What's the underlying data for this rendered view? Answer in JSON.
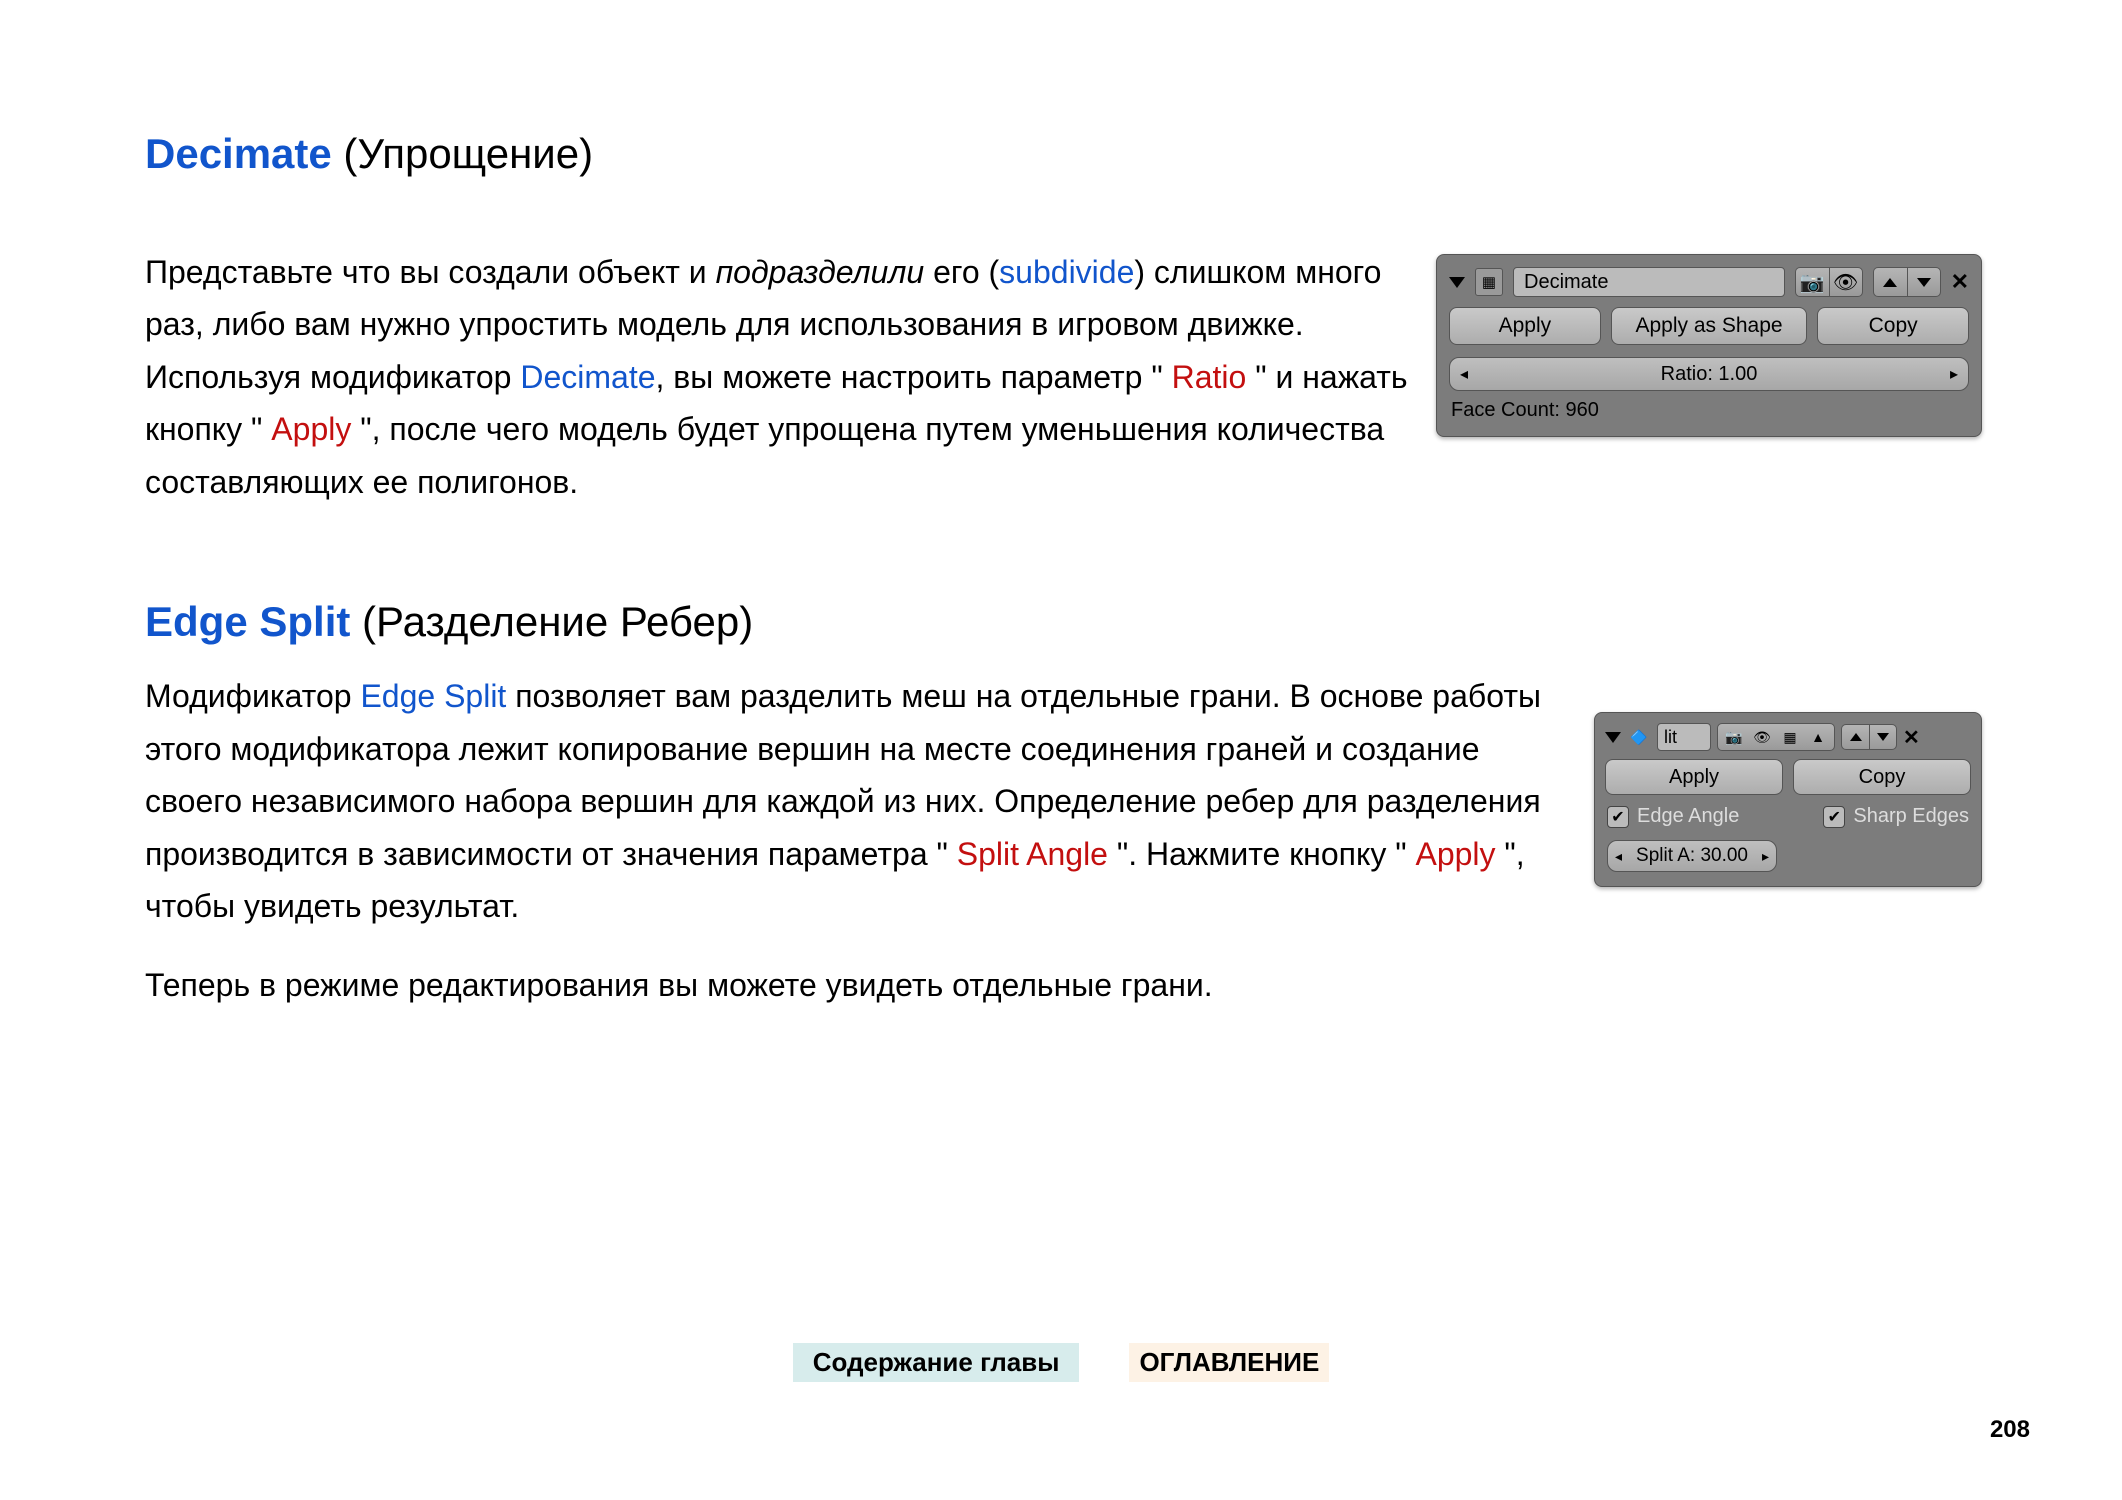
{
  "section1": {
    "heading_en": "Decimate",
    "heading_ru": " (Упрощение)",
    "body": {
      "t1": "Представьте что вы создали объект и ",
      "t2_italic": "подразделили",
      "t3": " его (",
      "t4_link": "subdivide",
      "t5": ") слишком много раз, либо вам нужно упростить модель для использования в игровом движке. Используя модификатор ",
      "t6_link": "Decimate",
      "t7": ", вы можете настроить параметр \" ",
      "t8_red": "Ratio",
      "t9": " \" и нажать кнопку \" ",
      "t10_red": "Apply",
      "t11": " \", после чего модель будет упрощена путем уменьшения количества составляющих ее полигонов."
    }
  },
  "panel_decimate": {
    "name": "Decimate",
    "apply": "Apply",
    "apply_shape": "Apply as Shape",
    "copy": "Copy",
    "ratio_label": "Ratio: 1.00",
    "face_count": "Face Count: 960"
  },
  "section2": {
    "heading_en": "Edge Split",
    "heading_ru": " (Разделение Ребер)",
    "body": {
      "t1": "Модификатор ",
      "t2_link": "Edge Split",
      "t3": " позволяет вам разделить меш на отдельные грани. В основе работы этого модификатора лежит копирование вершин на месте соединения граней и создание своего независимого набора вершин для каждой из них. Определение ребер для разделения производится в зависимости от значения параметра \" ",
      "t4_red": "Split Angle",
      "t5": " \". Нажмите кнопку \" ",
      "t6_red": "Apply",
      "t7": " \", чтобы увидеть результат."
    },
    "body2": "Теперь в режиме редактирования вы можете увидеть отдельные грани."
  },
  "panel_edge": {
    "name": "lit",
    "apply": "Apply",
    "copy": "Copy",
    "edge_angle": "Edge Angle",
    "sharp_edges": "Sharp Edges",
    "split_label": "Split A: 30.00"
  },
  "footer": {
    "nav1": "Содержание главы",
    "nav2": "ОГЛАВЛЕНИЕ",
    "page_number": "208"
  }
}
